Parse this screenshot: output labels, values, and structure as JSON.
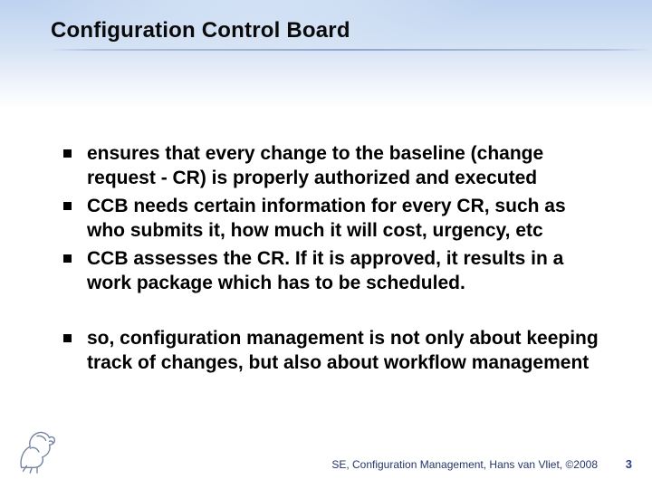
{
  "title": "Configuration Control Board",
  "bullets_a": [
    "ensures that every change to the baseline (change request - CR) is properly authorized and executed",
    "CCB needs certain information for every CR, such as who submits it, how much it will cost, urgency, etc",
    "CCB assesses the CR. If it is approved, it results in a work package which has to be scheduled."
  ],
  "bullets_b": [
    "so, configuration management is not only about keeping track of changes, but also about workflow management"
  ],
  "footer": "SE, Configuration Management, Hans van Vliet, ©2008",
  "page_number": "3"
}
